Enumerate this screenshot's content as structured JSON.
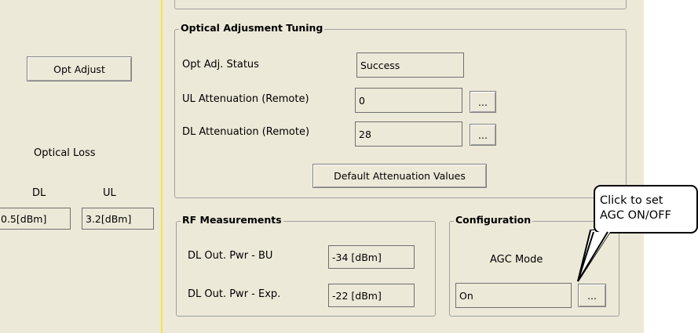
{
  "left": {
    "opt_adjust_button": "Opt Adjust",
    "optical_loss_label": "Optical Loss",
    "dl_label": "DL",
    "ul_label": "UL",
    "dl_value": "0.5[dBm]",
    "ul_value": "3.2[dBm]"
  },
  "tuning": {
    "title": "Optical Adjusment Tuning",
    "status_label": "Opt Adj. Status",
    "status_value": "Success",
    "ul_att_label": "UL Attenuation (Remote)",
    "ul_att_value": "0",
    "dl_att_label": "DL Attenuation (Remote)",
    "dl_att_value": "28",
    "ellipsis": "...",
    "default_button": "Default Attenuation Values"
  },
  "rf": {
    "title": "RF Measurements",
    "bu_label": "DL Out. Pwr - BU",
    "bu_value": "-34 [dBm]",
    "exp_label": "DL Out. Pwr - Exp.",
    "exp_value": "-22 [dBm]"
  },
  "config": {
    "title": "Configuration",
    "agc_label": "AGC Mode",
    "agc_value": "On",
    "ellipsis": "..."
  },
  "callout": {
    "line1": "Click to set",
    "line2": "AGC ON/OFF"
  }
}
